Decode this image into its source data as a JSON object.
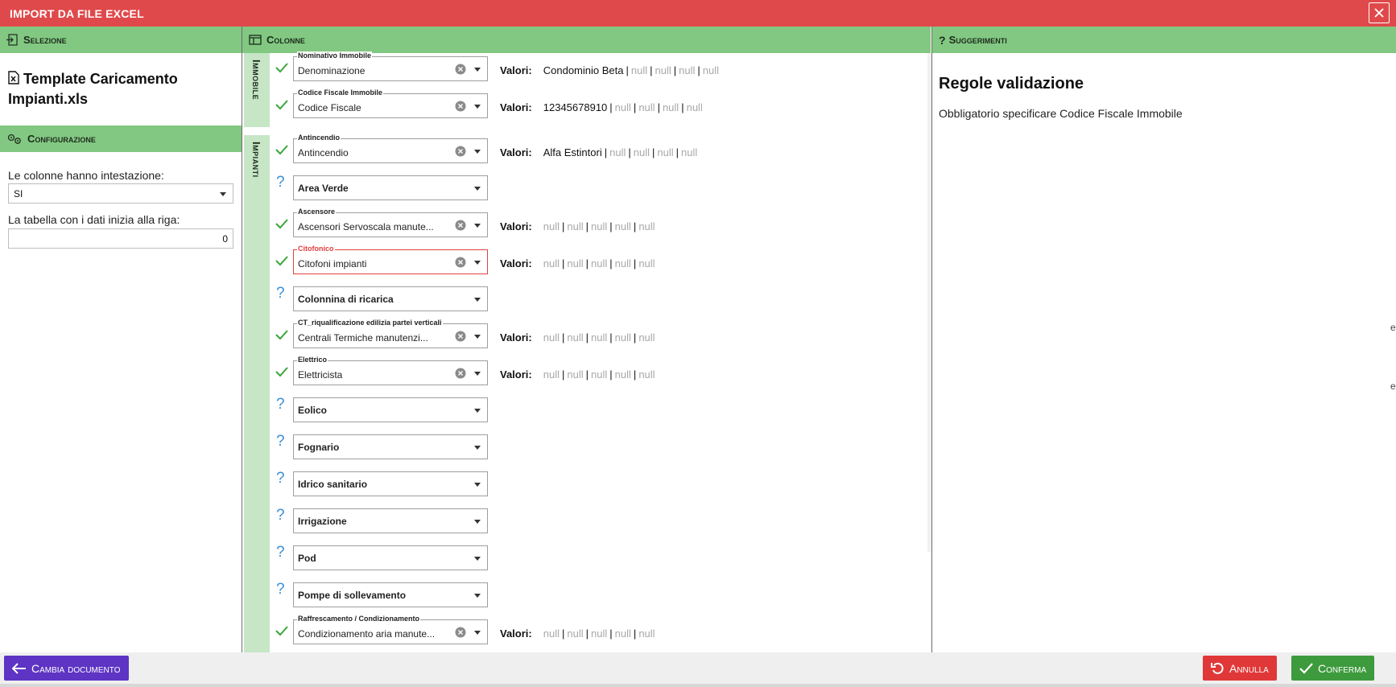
{
  "window": {
    "title": "IMPORT DA FILE EXCEL"
  },
  "panels": {
    "selezione": "Selezione",
    "colonne": "Colonne",
    "suggerimenti": "Suggerimenti",
    "configurazione": "Configurazione"
  },
  "selezione": {
    "document_name": "Template Caricamento Impianti.xls"
  },
  "configurazione": {
    "header_label": "Le colonne hanno intestazione:",
    "header_value": "SI",
    "start_row_label": "La tabella con i dati inizia alla riga:",
    "start_row_value": "0"
  },
  "groups": {
    "immobile": "Immobile",
    "impianti": "Impianti"
  },
  "valori_label": "Valori:",
  "rows": [
    {
      "status": "check",
      "label": "Nominativo Immobile",
      "value": "Denominazione",
      "error": false,
      "values": [
        "Condominio Beta",
        "null",
        "null",
        "null",
        "null"
      ]
    },
    {
      "status": "check",
      "label": "Codice Fiscale Immobile",
      "value": "Codice Fiscale",
      "error": false,
      "values": [
        "12345678910",
        "null",
        "null",
        "null",
        "null"
      ]
    },
    {
      "status": "check",
      "label": "Antincendio",
      "value": "Antincendio",
      "error": false,
      "values": [
        "Alfa Estintori",
        "null",
        "null",
        "null",
        "null"
      ]
    },
    {
      "status": "question",
      "label": "",
      "value": "Area Verde",
      "error": false,
      "values": []
    },
    {
      "status": "check",
      "label": "Ascensore",
      "value": "Ascensori Servoscala manute...",
      "error": false,
      "values": [
        "null",
        "null",
        "null",
        "null",
        "null"
      ]
    },
    {
      "status": "check",
      "label": "Citofonico",
      "value": "Citofoni impianti",
      "error": true,
      "values": [
        "null",
        "null",
        "null",
        "null",
        "null"
      ]
    },
    {
      "status": "question",
      "label": "",
      "value": "Colonnina di ricarica",
      "error": false,
      "values": []
    },
    {
      "status": "check",
      "label": "CT_riqualificazione edilizia partei verticali",
      "value": "Centrali Termiche manutenzi...",
      "error": false,
      "values": [
        "null",
        "null",
        "null",
        "null",
        "null"
      ]
    },
    {
      "status": "check",
      "label": "Elettrico",
      "value": "Elettricista",
      "error": false,
      "values": [
        "null",
        "null",
        "null",
        "null",
        "null"
      ]
    },
    {
      "status": "question",
      "label": "",
      "value": "Eolico",
      "error": false,
      "values": []
    },
    {
      "status": "question",
      "label": "",
      "value": "Fognario",
      "error": false,
      "values": []
    },
    {
      "status": "question",
      "label": "",
      "value": "Idrico sanitario",
      "error": false,
      "values": []
    },
    {
      "status": "question",
      "label": "",
      "value": "Irrigazione",
      "error": false,
      "values": []
    },
    {
      "status": "question",
      "label": "",
      "value": "Pod",
      "error": false,
      "values": []
    },
    {
      "status": "question",
      "label": "",
      "value": "Pompe di sollevamento",
      "error": false,
      "values": []
    },
    {
      "status": "check",
      "label": "Raffrescamento / Condizionamento",
      "value": "Condizionamento aria manute...",
      "error": false,
      "values": [
        "null",
        "null",
        "null",
        "null",
        "null"
      ]
    }
  ],
  "suggerimenti": {
    "title": "Regole validazione",
    "text": "Obbligatorio specificare Codice Fiscale Immobile"
  },
  "edge_chars": [
    "e",
    "e"
  ],
  "footer": {
    "cambia": "Cambia documento",
    "annulla": "Annulla",
    "conferma": "Conferma"
  },
  "colors": {
    "titlebar": "#e0494b",
    "header": "#82c882",
    "check": "#3aa63a",
    "question": "#3a8fd6",
    "error": "#e04040"
  }
}
